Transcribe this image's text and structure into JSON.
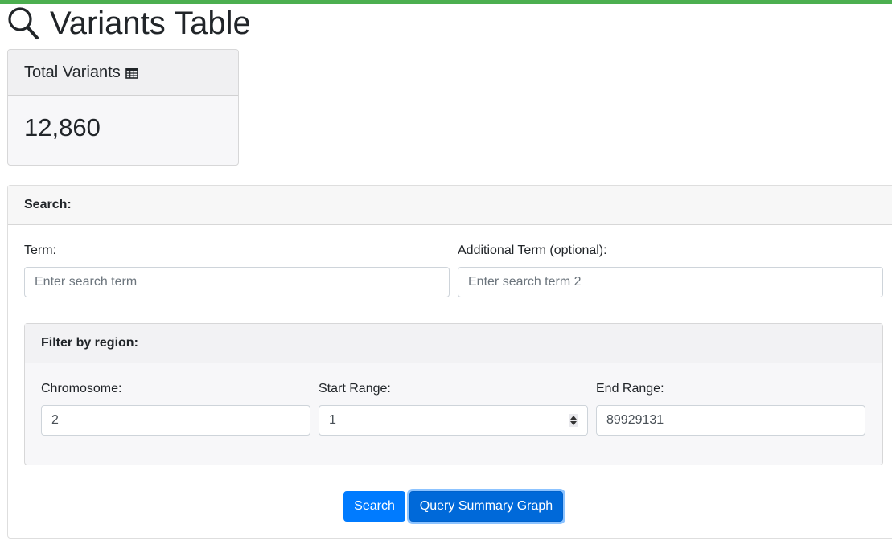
{
  "colors": {
    "accent_bar": "#4caf50",
    "primary": "#007bff"
  },
  "page": {
    "title": "Variants Table",
    "title_icon": "search-icon"
  },
  "stats": {
    "total_label": "Total Variants",
    "total_icon": "table-icon",
    "total_value": "12,860"
  },
  "search": {
    "header": "Search:",
    "term_label": "Term:",
    "term_placeholder": "Enter search term",
    "term_value": "",
    "additional_label": "Additional Term (optional):",
    "additional_placeholder": "Enter search term 2",
    "additional_value": "",
    "region": {
      "header": "Filter by region:",
      "chromosome_label": "Chromosome:",
      "chromosome_value": "2",
      "start_label": "Start Range:",
      "start_value": "1",
      "end_label": "End Range:",
      "end_value": "89929131"
    },
    "buttons": {
      "search": "Search",
      "summary_graph": "Query Summary Graph"
    }
  }
}
